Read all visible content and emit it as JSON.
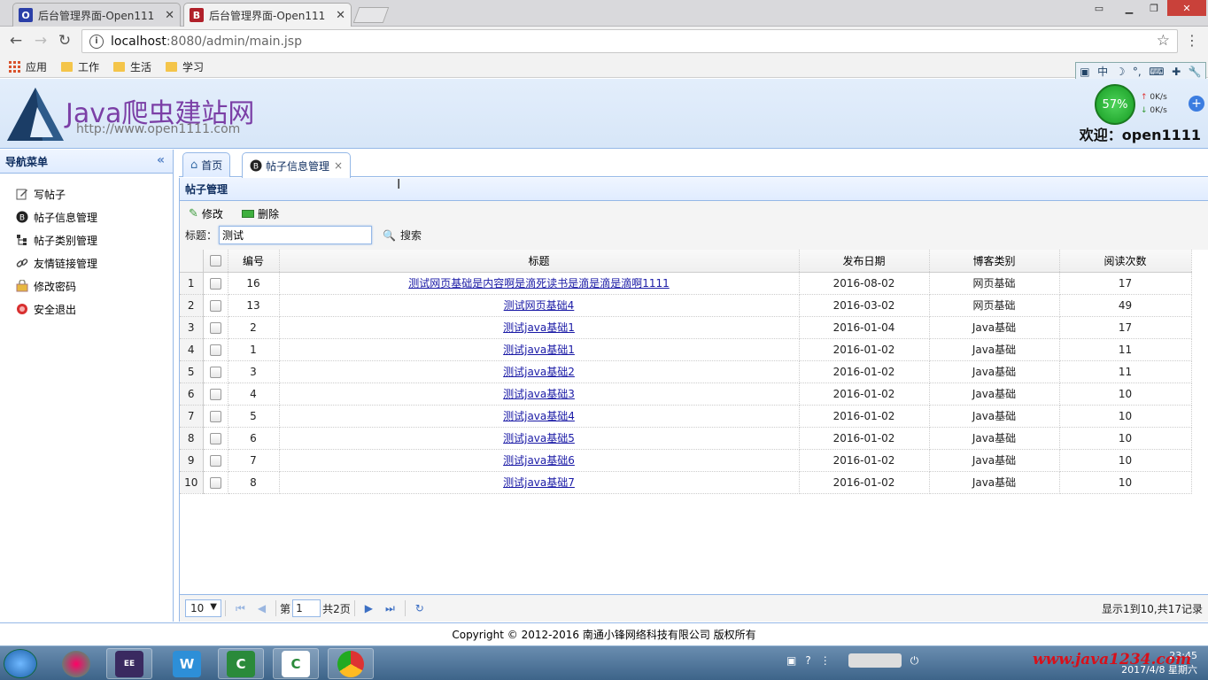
{
  "browser": {
    "tabs": [
      {
        "title": "后台管理界面-Open111",
        "favicon": "O",
        "favicon_color": "#2b3fa8",
        "active": false
      },
      {
        "title": "后台管理界面-Open111",
        "favicon": "B",
        "favicon_color": "#b0202a",
        "active": true
      }
    ],
    "url_host": "localhost",
    "url_rest": ":8080/admin/main.jsp",
    "bookmarks": [
      "应用",
      "工作",
      "生活",
      "学习"
    ],
    "ime": [
      "中"
    ]
  },
  "speed_widget": {
    "percent": "57%",
    "up": "0K/s",
    "down": "0K/s"
  },
  "header": {
    "logo_text": "Java爬虫建站网",
    "logo_url": "http://www.open1111.com",
    "welcome": "欢迎：open1111"
  },
  "sidebar": {
    "title": "导航菜单",
    "items": [
      {
        "label": "写帖子",
        "icon": "edit-icon"
      },
      {
        "label": "帖子信息管理",
        "icon": "blog-icon"
      },
      {
        "label": "帖子类别管理",
        "icon": "tree-icon"
      },
      {
        "label": "友情链接管理",
        "icon": "link-icon"
      },
      {
        "label": "修改密码",
        "icon": "lock-icon"
      },
      {
        "label": "安全退出",
        "icon": "exit-icon"
      }
    ]
  },
  "tabs": [
    {
      "label": "首页",
      "icon": "home-icon"
    },
    {
      "label": "帖子信息管理",
      "icon": "blog-icon"
    }
  ],
  "panel": {
    "title": "帖子管理",
    "edit_label": "修改",
    "delete_label": "删除",
    "search_label": "标题：",
    "search_value": "测试",
    "search_button": "搜索"
  },
  "table": {
    "headers": [
      "编号",
      "标题",
      "发布日期",
      "博客类别",
      "阅读次数"
    ],
    "rows": [
      {
        "rn": "1",
        "id": "16",
        "title": "测试网页基础是内容啊是滴死读书是滴是滴是滴啊1111",
        "date": "2016-08-02",
        "type": "网页基础",
        "reads": "17"
      },
      {
        "rn": "2",
        "id": "13",
        "title": "测试网页基础4",
        "date": "2016-03-02",
        "type": "网页基础",
        "reads": "49"
      },
      {
        "rn": "3",
        "id": "2",
        "title": "测试java基础1",
        "date": "2016-01-04",
        "type": "Java基础",
        "reads": "17"
      },
      {
        "rn": "4",
        "id": "1",
        "title": "测试java基础1",
        "date": "2016-01-02",
        "type": "Java基础",
        "reads": "11"
      },
      {
        "rn": "5",
        "id": "3",
        "title": "测试java基础2",
        "date": "2016-01-02",
        "type": "Java基础",
        "reads": "11"
      },
      {
        "rn": "6",
        "id": "4",
        "title": "测试java基础3",
        "date": "2016-01-02",
        "type": "Java基础",
        "reads": "10"
      },
      {
        "rn": "7",
        "id": "5",
        "title": "测试java基础4",
        "date": "2016-01-02",
        "type": "Java基础",
        "reads": "10"
      },
      {
        "rn": "8",
        "id": "6",
        "title": "测试java基础5",
        "date": "2016-01-02",
        "type": "Java基础",
        "reads": "10"
      },
      {
        "rn": "9",
        "id": "7",
        "title": "测试java基础6",
        "date": "2016-01-02",
        "type": "Java基础",
        "reads": "10"
      },
      {
        "rn": "10",
        "id": "8",
        "title": "测试java基础7",
        "date": "2016-01-02",
        "type": "Java基础",
        "reads": "10"
      }
    ]
  },
  "pager": {
    "page_size": "10",
    "page_prefix": "第",
    "page_value": "1",
    "page_total": "共2页",
    "info": "显示1到10,共17记录"
  },
  "footer": {
    "text": "Copyright © 2012-2016 南通小锋网络科技有限公司 版权所有"
  },
  "taskbar": {
    "clock_time": "23:45",
    "clock_date": "2017/4/8 星期六",
    "watermark": "www.java1234.com"
  }
}
